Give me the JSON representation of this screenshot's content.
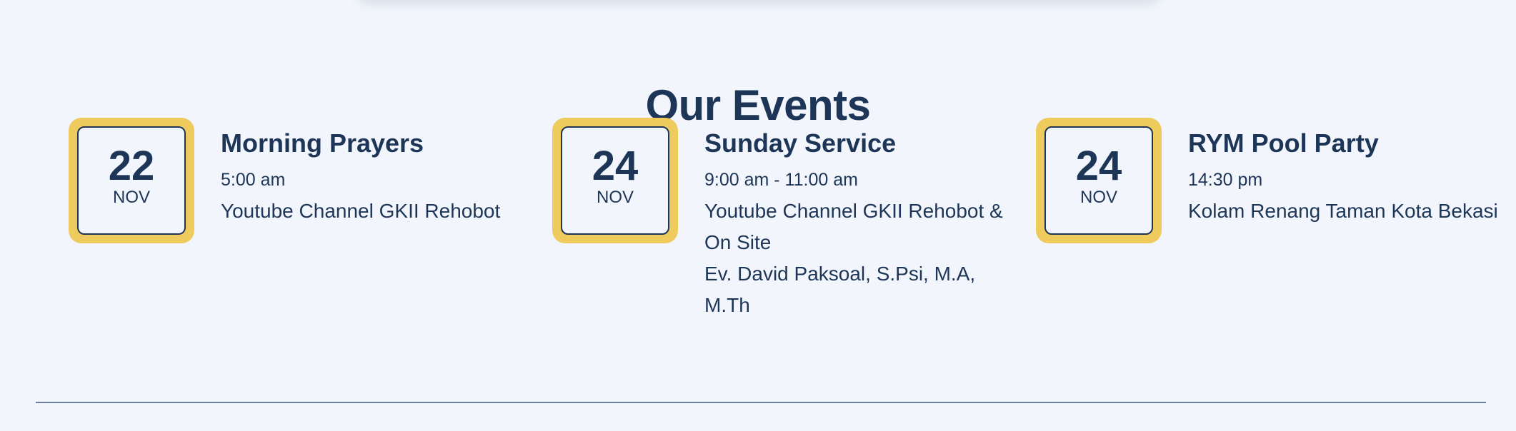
{
  "section": {
    "title": "Our Events"
  },
  "events": [
    {
      "day": "22",
      "month": "NOV",
      "name": "Morning Prayers",
      "time": "5:00 am",
      "location": "Youtube Channel GKII Rehobot",
      "speaker": ""
    },
    {
      "day": "24",
      "month": "NOV",
      "name": "Sunday Service",
      "time": "9:00 am - 11:00 am",
      "location": "Youtube Channel GKII Rehobot & On Site",
      "speaker": "Ev. David Paksoal, S.Psi, M.A, M.Th"
    },
    {
      "day": "24",
      "month": "NOV",
      "name": "RYM Pool Party",
      "time": "14:30 pm",
      "location": "Kolam Renang Taman Kota Bekasi",
      "speaker": ""
    }
  ],
  "colors": {
    "background": "#f2f6fc",
    "text": "#1d3557",
    "badge": "#eecb5c",
    "divider": "#6c7f9c"
  }
}
